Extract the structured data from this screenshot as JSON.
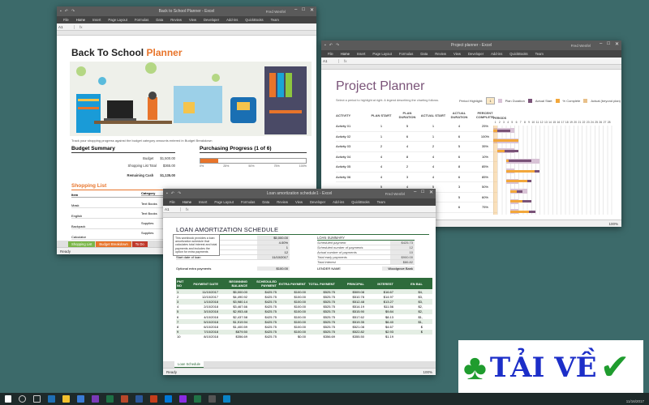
{
  "w1": {
    "title": "Back to School Planner  -  Excel",
    "user": "Fred Wenfel",
    "namebox": "A1",
    "tabs": [
      "File",
      "Home",
      "Insert",
      "Page Layout",
      "Formulas",
      "Data",
      "Review",
      "View",
      "Developer",
      "Add-ins",
      "QuickBooks",
      "Team"
    ],
    "heading_a": "Back To School",
    "heading_b": "Planner",
    "description": "Track your shopping progress against the budget category amounts entered in Budget Breakdown",
    "budget_summary": {
      "title": "Budget Summary",
      "rows": [
        {
          "label": "Budget",
          "value": "$1,500.00"
        },
        {
          "label": "Shopping List Total",
          "value": "$365.00"
        }
      ],
      "remaining_label": "Remaining Cash",
      "remaining_value": "$1,135.00"
    },
    "purchasing": {
      "title": "Purchasing Progress (1 of 6)",
      "progress": 0.17,
      "ticks": [
        "0%",
        "25%",
        "50%",
        "75%",
        "100%"
      ]
    },
    "shopping_list": {
      "title": "Shopping List",
      "col_item": "Item",
      "col_category": "Category",
      "items": [
        "Mask",
        "English",
        "Backpack",
        "Calculator"
      ],
      "categories": [
        "Text Books",
        "Text Books",
        "Supplies",
        "Supplies"
      ]
    },
    "sheet_tabs": [
      "Shopping List",
      "Budget Breakdown",
      "To Do"
    ],
    "status": "Ready"
  },
  "w2": {
    "title": "Project planner  -  Excel",
    "user": "Fred Wenfel",
    "namebox": "A1",
    "tabs": [
      "File",
      "Home",
      "Insert",
      "Page Layout",
      "Formulas",
      "Data",
      "Review",
      "View",
      "Developer",
      "Add-ins",
      "QuickBooks",
      "Team"
    ],
    "heading": "Project Planner",
    "subtitle": "Select a period to highlight at right. A legend describing the charting follows.",
    "period_highlight": "Period Highlight:",
    "period_value": "1",
    "legend": [
      "Plan Duration",
      "Actual Start",
      "% Complete",
      "Actual (beyond plan)"
    ],
    "colors": {
      "plan": "#d8c3d6",
      "actual": "#7a5378",
      "complete": "#f2a73b",
      "beyond": "#e8c08a"
    },
    "columns": [
      "ACTIVITY",
      "PLAN START",
      "PLAN DURATION",
      "ACTUAL START",
      "ACTUAL DURATION",
      "PERCENT COMPLETE"
    ],
    "periods_label": "PERIODS",
    "period_numbers": [
      "1",
      "2",
      "3",
      "4",
      "5",
      "6",
      "7",
      "8",
      "9",
      "10",
      "11",
      "12",
      "13",
      "14",
      "15",
      "16",
      "17",
      "18",
      "19",
      "20",
      "21",
      "22",
      "23",
      "24",
      "25",
      "26",
      "27",
      "28"
    ],
    "rows": [
      {
        "activity": "Activity 01",
        "ps": "1",
        "pd": "5",
        "as": "1",
        "ad": "4",
        "pc": "25%"
      },
      {
        "activity": "Activity 02",
        "ps": "1",
        "pd": "6",
        "as": "1",
        "ad": "6",
        "pc": "100%"
      },
      {
        "activity": "Activity 03",
        "ps": "2",
        "pd": "4",
        "as": "2",
        "ad": "5",
        "pc": "35%"
      },
      {
        "activity": "Activity 04",
        "ps": "4",
        "pd": "8",
        "as": "4",
        "ad": "6",
        "pc": "10%"
      },
      {
        "activity": "Activity 05",
        "ps": "4",
        "pd": "2",
        "as": "4",
        "ad": "8",
        "pc": "85%"
      },
      {
        "activity": "Activity 06",
        "ps": "4",
        "pd": "3",
        "as": "4",
        "ad": "6",
        "pc": "85%"
      },
      {
        "activity": "",
        "ps": "5",
        "pd": "4",
        "as": "5",
        "ad": "3",
        "pc": "50%"
      },
      {
        "activity": "",
        "ps": "5",
        "pd": "2",
        "as": "5",
        "ad": "5",
        "pc": "60%"
      },
      {
        "activity": "",
        "ps": "5",
        "pd": "2",
        "as": "5",
        "ad": "6",
        "pc": "75%"
      }
    ],
    "status": "Ready",
    "zoom": "100%"
  },
  "w3": {
    "title": "Loan amortization schedule1  -  Excel",
    "user": "Fred Wenfel",
    "namebox": "A1",
    "tabs": [
      "File",
      "Home",
      "Insert",
      "Page Layout",
      "Formulas",
      "Data",
      "Review",
      "View",
      "Developer",
      "Add-ins",
      "QuickBooks",
      "Team"
    ],
    "heading": "LOAN AMORTIZATION SCHEDULE",
    "note": "This workbook provides a loan amortization schedule that calculates total interest and total payments and includes the option for extra payments",
    "left_rows": [
      {
        "label": "LUES",
        "value": "$5,000.00"
      },
      {
        "label": "nual interest rate",
        "value": "4.00%"
      },
      {
        "label": "n in years",
        "value": "1"
      },
      {
        "label": "mber of payments per year",
        "value": "12"
      },
      {
        "label": "Start date of loan",
        "value": "11/10/2017"
      }
    ],
    "extra_label": "Optional extra payments",
    "extra_value": "$100.00",
    "summary_title": "LOAN SUMMARY",
    "right_rows": [
      {
        "label": "Scheduled payment",
        "value": "$425.73"
      },
      {
        "label": "Scheduled number of payments",
        "value": "12"
      },
      {
        "label": "Actual number of payments",
        "value": "10"
      },
      {
        "label": "Total early payments",
        "value": "$900.00"
      },
      {
        "label": "Total interest",
        "value": "$86.82"
      }
    ],
    "lender_label": "LENDER NAME",
    "lender_value": "Woodgrove Bank",
    "columns": [
      "PMT NO",
      "PAYMENT DATE",
      "BEGINNING BALANCE",
      "SCHEDULED PAYMENT",
      "EXTRA PAYMENT",
      "TOTAL PAYMENT",
      "PRINCIPAL",
      "INTEREST",
      "EN BAL",
      ""
    ],
    "rows": [
      [
        "1",
        "11/10/2017",
        "$5,000.00",
        "$425.75",
        "$100.00",
        "$525.75",
        "$509.08",
        "$16.67",
        "$4,"
      ],
      [
        "2",
        "12/10/2017",
        "$4,490.92",
        "$425.75",
        "$100.00",
        "$525.75",
        "$510.78",
        "$14.97",
        "$3,"
      ],
      [
        "3",
        "1/10/2018",
        "$3,980.14",
        "$425.75",
        "$100.00",
        "$525.75",
        "$512.48",
        "$13.27",
        "$3,"
      ],
      [
        "4",
        "2/10/2018",
        "$3,467.66",
        "$425.75",
        "$100.00",
        "$525.75",
        "$514.19",
        "$11.56",
        "$2,"
      ],
      [
        "5",
        "3/10/2018",
        "$2,953.48",
        "$425.75",
        "$100.00",
        "$525.75",
        "$515.90",
        "$9.84",
        "$2,"
      ],
      [
        "6",
        "4/10/2018",
        "$2,437.58",
        "$425.75",
        "$100.00",
        "$525.75",
        "$517.62",
        "$8.13",
        "$1,"
      ],
      [
        "7",
        "5/10/2018",
        "$1,919.94",
        "$425.75",
        "$100.00",
        "$525.75",
        "$519.35",
        "$6.40",
        "$1,"
      ],
      [
        "8",
        "6/10/2018",
        "$1,400.59",
        "$425.75",
        "$100.00",
        "$525.75",
        "$521.08",
        "$4.67",
        "$"
      ],
      [
        "9",
        "7/10/2018",
        "$879.50",
        "$425.75",
        "$100.00",
        "$525.75",
        "$522.82",
        "$2.93",
        "$"
      ],
      [
        "10",
        "8/10/2018",
        "$356.69",
        "$425.75",
        "$0.00",
        "$356.69",
        "$355.50",
        "$1.19",
        ""
      ]
    ],
    "sheet_tab": "Loan Schedule",
    "status": "Ready",
    "zoom": "100%"
  },
  "clock": {
    "time": "",
    "date": "11/16/2017"
  },
  "brand": {
    "text": "TẢI VỀ"
  }
}
